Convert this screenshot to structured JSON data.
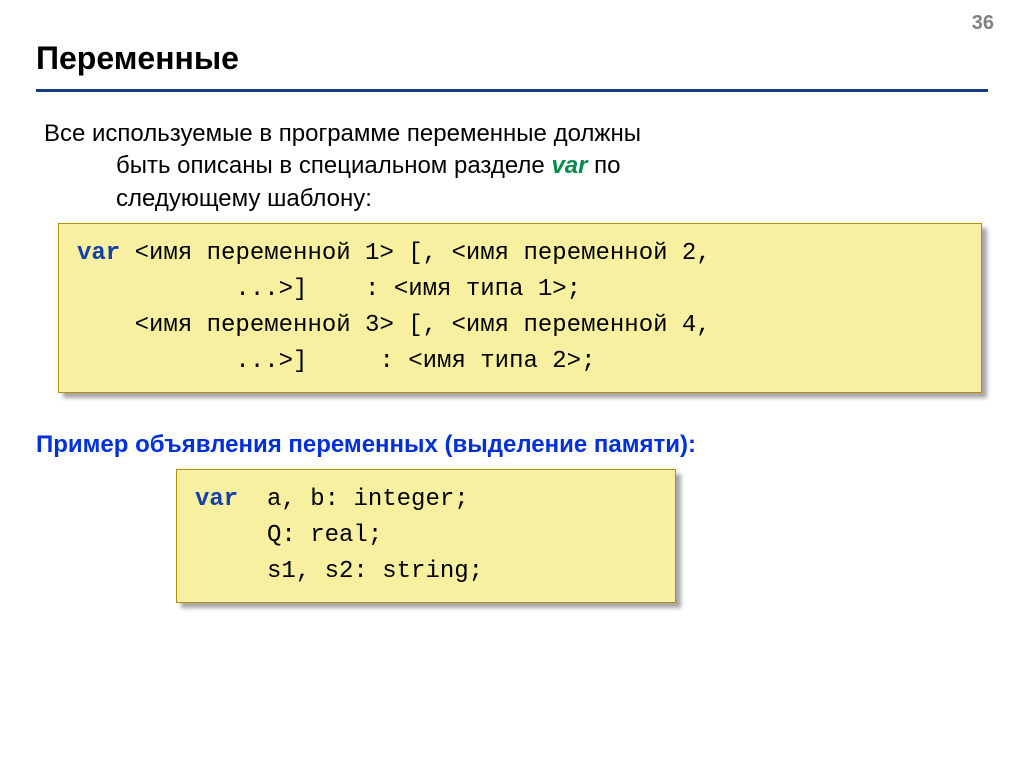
{
  "page_number": "36",
  "title": "Переменные",
  "intro": {
    "line1": "Все используемые в программе переменные должны",
    "line2_pre": "быть описаны в специальном разделе ",
    "var_kw": "var",
    "line2_post": " по",
    "line3": "следующему шаблону:"
  },
  "code1": {
    "l1": "var <имя переменной 1> [, <имя переменной 2,",
    "l2": "           ...>]    : <имя типа 1>;",
    "l3": "    <имя переменной 3> [, <имя переменной 4,",
    "l4": "           ...>]     : <имя типа 2>;"
  },
  "subtitle": "Пример объявления переменных (выделение памяти):",
  "code2": {
    "kw": "var",
    "l1_rest": "  a, b: integer;",
    "l2": "     Q: real;",
    "l3": "     s1, s2: string;"
  }
}
